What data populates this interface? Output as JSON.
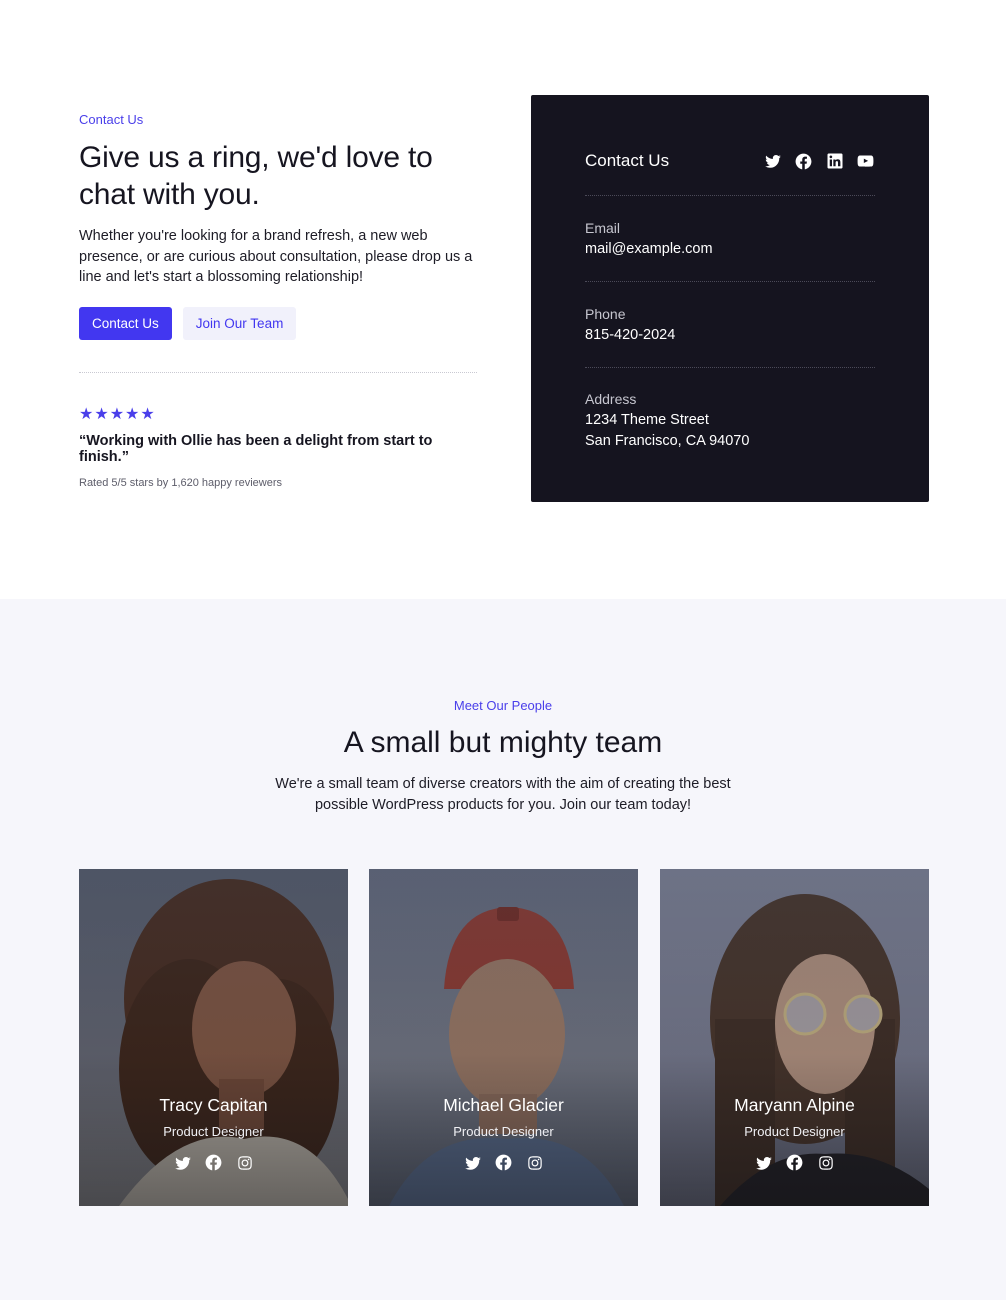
{
  "contact": {
    "eyebrow": "Contact Us",
    "headline": "Give us a ring, we'd love to chat with you.",
    "lead": "Whether you're looking for a brand refresh, a new web presence, or are curious about consultation, please drop us a line and let's start a blossoming relationship!",
    "primary_button": "Contact Us",
    "secondary_button": "Join Our Team",
    "stars": "★★★★★",
    "quote": "“Working with Ollie has been a delight from start to finish.”",
    "rating": "Rated 5/5 stars by 1,620 happy reviewers"
  },
  "card": {
    "title": "Contact Us",
    "socials": [
      "twitter-icon",
      "facebook-icon",
      "linkedin-icon",
      "youtube-icon"
    ],
    "email_label": "Email",
    "email_value": "mail@example.com",
    "phone_label": "Phone",
    "phone_value": "815-420-2024",
    "address_label": "Address",
    "address_line1": "1234 Theme Street",
    "address_line2": "San Francisco, CA 94070"
  },
  "team": {
    "eyebrow": "Meet Our People",
    "title": "A small but mighty team",
    "lead": "We're a small team of diverse creators with the aim of creating the best possible WordPress products for you. Join our team today!",
    "members": [
      {
        "name": "Tracy Capitan",
        "role": "Product Designer"
      },
      {
        "name": "Michael Glacier",
        "role": "Product Designer"
      },
      {
        "name": "Maryann Alpine",
        "role": "Product Designer"
      }
    ],
    "member_socials": [
      "twitter-icon",
      "facebook-icon",
      "instagram-icon"
    ]
  },
  "colors": {
    "accent": "#4237f0",
    "card_bg": "#15141f",
    "team_bg": "#f6f6fb"
  }
}
